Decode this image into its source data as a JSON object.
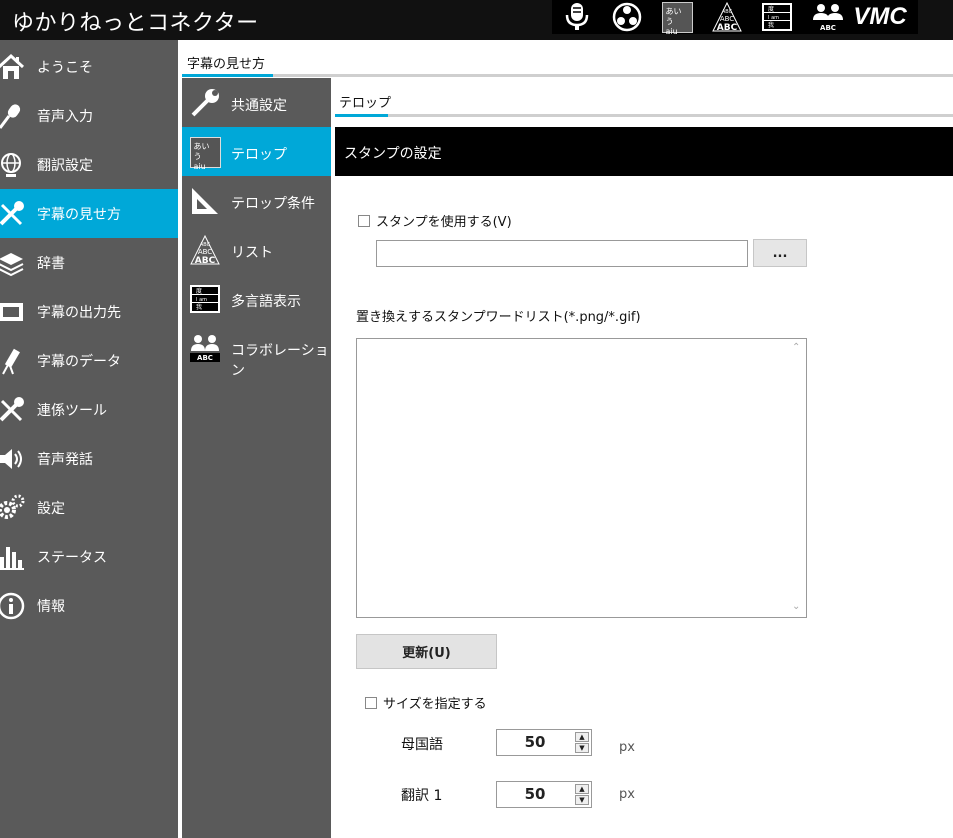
{
  "app": {
    "title": "ゆかりねっとコネクター"
  },
  "toolbar": {
    "tools": [
      {
        "name": "microphone-icon"
      },
      {
        "name": "obs-icon"
      },
      {
        "name": "aiu-icon",
        "label_top": "あいう",
        "label_bottom": "aiu"
      },
      {
        "name": "abc-chart-icon"
      },
      {
        "name": "multilang-icon",
        "lines": [
          "度",
          "I am",
          "我"
        ]
      },
      {
        "name": "collab-icon",
        "label": "ABC"
      },
      {
        "name": "vmc-icon",
        "label": "VMC"
      }
    ]
  },
  "sidebar": {
    "items": [
      {
        "label": "ようこそ",
        "icon": "home-icon"
      },
      {
        "label": "音声入力",
        "icon": "microphone-icon"
      },
      {
        "label": "翻訳設定",
        "icon": "globe-icon"
      },
      {
        "label": "字幕の見せ方",
        "icon": "tools-icon",
        "active": true
      },
      {
        "label": "辞書",
        "icon": "layers-icon"
      },
      {
        "label": "字幕の出力先",
        "icon": "film-icon"
      },
      {
        "label": "字幕のデータ",
        "icon": "telescope-icon"
      },
      {
        "label": "連係ツール",
        "icon": "tools-icon"
      },
      {
        "label": "音声発話",
        "icon": "speaker-icon"
      },
      {
        "label": "設定",
        "icon": "gears-icon"
      },
      {
        "label": "ステータス",
        "icon": "bar-chart-icon"
      },
      {
        "label": "情報",
        "icon": "info-icon"
      }
    ]
  },
  "section": {
    "title": "字幕の見せ方"
  },
  "subnav": {
    "items": [
      {
        "label": "共通設定",
        "icon": "wrench-icon"
      },
      {
        "label": "テロップ",
        "icon": "aiu-icon",
        "active": true,
        "icon_top": "あいう",
        "icon_bottom": "aiu"
      },
      {
        "label": "テロップ条件",
        "icon": "set-square-icon"
      },
      {
        "label": "リスト",
        "icon": "abc-chart-icon"
      },
      {
        "label": "多言語表示",
        "icon": "multilang-icon",
        "icon_lines": [
          "度",
          "I am",
          "我"
        ]
      },
      {
        "label": "コラボレーション",
        "icon": "collab-icon",
        "icon_label": "ABC"
      }
    ]
  },
  "content": {
    "tab": "テロップ",
    "section_title": "スタンプの設定",
    "use_stamp_label": "スタンプを使用する(V)",
    "stamp_folder_value": "",
    "browse_label": "...",
    "word_list_label": "置き換えするスタンプワードリスト(*.png/*.gif)",
    "word_list_value": "",
    "update_label": "更新(U)",
    "size_checkbox_label": "サイズを指定する",
    "sizes": [
      {
        "label": "母国語",
        "value": "50",
        "unit": "px"
      },
      {
        "label": "翻訳 1",
        "value": "50",
        "unit": "px"
      }
    ]
  },
  "colors": {
    "accent": "#00a8d8",
    "sidebar": "#5a5a5a",
    "titlebar": "#111111"
  }
}
